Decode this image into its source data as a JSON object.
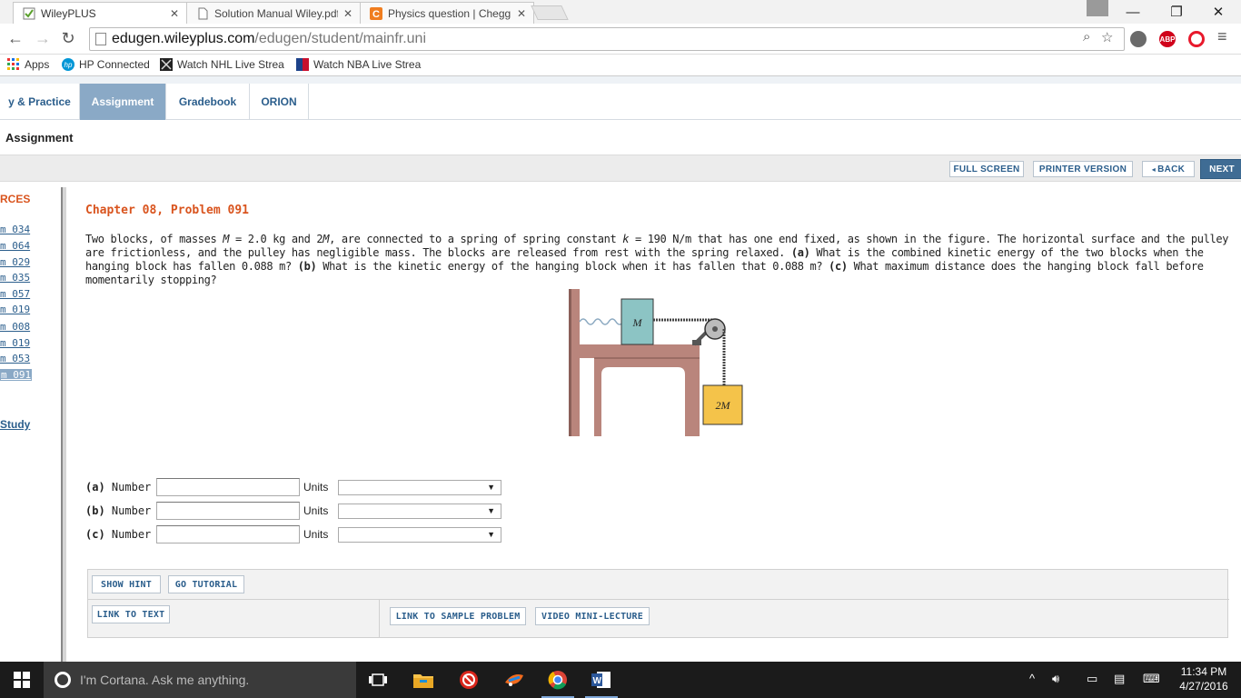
{
  "browser": {
    "tabs": [
      {
        "title": "WileyPLUS",
        "icon": "wileyplus-favicon",
        "active": true
      },
      {
        "title": "Solution Manual Wiley.pdf",
        "icon": "document-favicon",
        "active": false
      },
      {
        "title": "Physics question | Chegg.com",
        "icon": "chegg-favicon",
        "active": false
      }
    ],
    "url_host": "edugen.wileyplus.com",
    "url_path": "/edugen/student/mainfr.uni",
    "bookmarks": [
      {
        "label": "Apps",
        "icon": "apps-grid-icon"
      },
      {
        "label": "HP Connected",
        "icon": "hp-icon"
      },
      {
        "label": "Watch NHL Live Strea",
        "icon": "nhl-icon"
      },
      {
        "label": "Watch NBA Live Strea",
        "icon": "nba-icon"
      }
    ],
    "extensions": {
      "abp": "ABP"
    }
  },
  "page": {
    "nav_tabs": [
      {
        "label": "y & Practice",
        "active": false
      },
      {
        "label": "Assignment",
        "active": true
      },
      {
        "label": "Gradebook",
        "active": false
      },
      {
        "label": "ORION",
        "active": false
      }
    ],
    "section_title": "Assignment",
    "actions": {
      "full_screen": "FULL SCREEN",
      "printer_version": "PRINTER VERSION",
      "back": "BACK",
      "next": "NEXT"
    },
    "left_nav": {
      "title": "RCES",
      "items": [
        "m 034",
        "m 064",
        "m 029",
        "m 035",
        "m 057",
        "m 019",
        "m 008",
        "m 019",
        "m 053",
        "m 091"
      ],
      "selected_index": 9,
      "study_link": "Study"
    },
    "problem": {
      "title": "Chapter 08, Problem 091",
      "text_1": "Two blocks, of masses ",
      "text_2": "M",
      "text_3": " = 2.0 kg and 2",
      "text_4": "M",
      "text_5": ", are connected to a spring of spring constant ",
      "text_6": "k",
      "text_7": " = 190 N/m that has one end fixed, as shown in the figure. The horizontal surface and the pulley are frictionless, and the pulley has negligible mass. The blocks are released from rest with the spring relaxed. ",
      "part_a": "(a)",
      "text_8": " What is the combined kinetic energy of the two blocks when the hanging block has fallen 0.088 m? ",
      "part_b": "(b)",
      "text_9": " What is the kinetic energy of the hanging block when it has fallen that 0.088 m? ",
      "part_c": "(c)",
      "text_10": " What maximum distance does the hanging block fall before momentarily stopping?",
      "figure": {
        "block_top": "M",
        "block_hanging": "2M"
      }
    },
    "answers": [
      {
        "part": "(a)",
        "number_label": "Number",
        "units_label": "Units",
        "value": "",
        "unit": ""
      },
      {
        "part": "(b)",
        "number_label": "Number",
        "units_label": "Units",
        "value": "",
        "unit": ""
      },
      {
        "part": "(c)",
        "number_label": "Number",
        "units_label": "Units",
        "value": "",
        "unit": ""
      }
    ],
    "help_buttons": {
      "show_hint": "SHOW HINT",
      "go_tutorial": "GO TUTORIAL",
      "link_to_text": "LINK TO TEXT",
      "link_to_sample": "LINK TO SAMPLE PROBLEM",
      "video_lecture": "VIDEO MINI-LECTURE"
    }
  },
  "taskbar": {
    "cortana_placeholder": "I'm Cortana. Ask me anything.",
    "time": "11:34 PM",
    "date": "4/27/2016",
    "apps": [
      "task-view-icon",
      "file-explorer-icon",
      "blocked-app-icon",
      "paint-app-icon",
      "chrome-icon",
      "word-icon"
    ]
  },
  "colors": {
    "accent_orange": "#d9541e",
    "link_blue": "#2b5e8c",
    "active_tab": "#8aa9c6",
    "next_button": "#3f6c94"
  }
}
